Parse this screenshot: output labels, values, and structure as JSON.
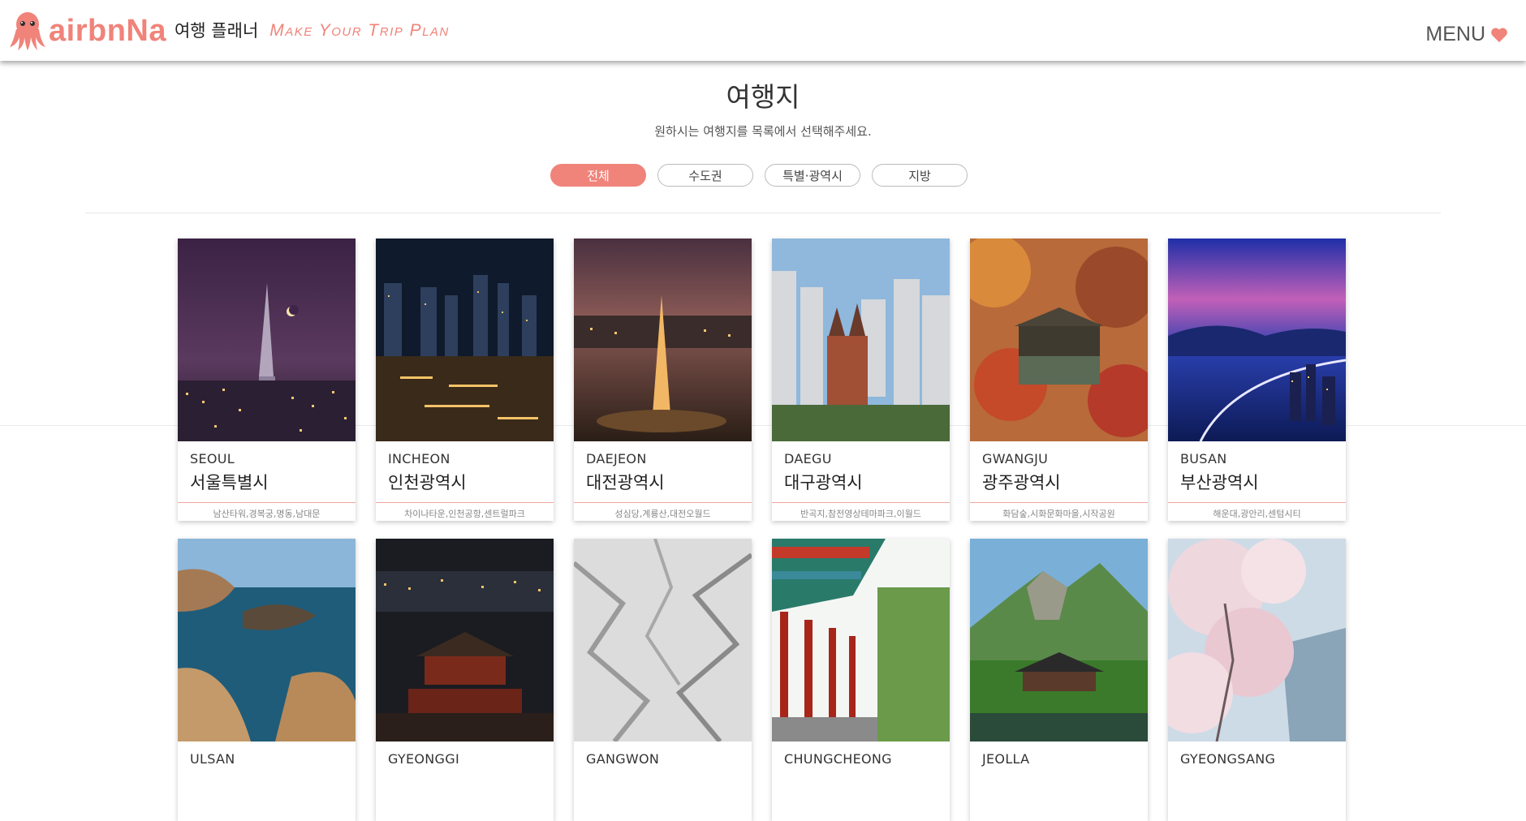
{
  "header": {
    "logo_text": "airbnNa",
    "planner_label": "여행 플래너",
    "tagline": "Make Your Trip Plan",
    "menu_label": "MENU",
    "accent_color": "#f0837a",
    "menu_icon": "heart-icon",
    "logo_icon": "octopus-icon"
  },
  "main": {
    "title": "여행지",
    "subtitle": "원하시는 여행지를 목록에서 선택해주세요.",
    "filters": [
      {
        "label": "전체",
        "active": true
      },
      {
        "label": "수도권",
        "active": false
      },
      {
        "label": "특별·광역시",
        "active": false
      },
      {
        "label": "지방",
        "active": false
      }
    ]
  },
  "cards": [
    {
      "en": "SEOUL",
      "ko": "서울특별시",
      "tags": "남산타워,경복궁,명동,남대문"
    },
    {
      "en": "INCHEON",
      "ko": "인천광역시",
      "tags": "차이나타운,인천공항,센트럴파크"
    },
    {
      "en": "DAEJEON",
      "ko": "대전광역시",
      "tags": "성심당,계룡산,대전오월드"
    },
    {
      "en": "DAEGU",
      "ko": "대구광역시",
      "tags": "반곡지,참전영상테마파크,이월드"
    },
    {
      "en": "GWANGJU",
      "ko": "광주광역시",
      "tags": "화담숲,시화문화마을,시작공원"
    },
    {
      "en": "BUSAN",
      "ko": "부산광역시",
      "tags": "해운대,광안리,센텀시티"
    },
    {
      "en": "ULSAN",
      "ko": "",
      "tags": ""
    },
    {
      "en": "GYEONGGI",
      "ko": "",
      "tags": ""
    },
    {
      "en": "GANGWON",
      "ko": "",
      "tags": ""
    },
    {
      "en": "CHUNGCHEONG",
      "ko": "",
      "tags": ""
    },
    {
      "en": "JEOLLA",
      "ko": "",
      "tags": ""
    },
    {
      "en": "GYEONGSANG",
      "ko": "",
      "tags": ""
    }
  ]
}
